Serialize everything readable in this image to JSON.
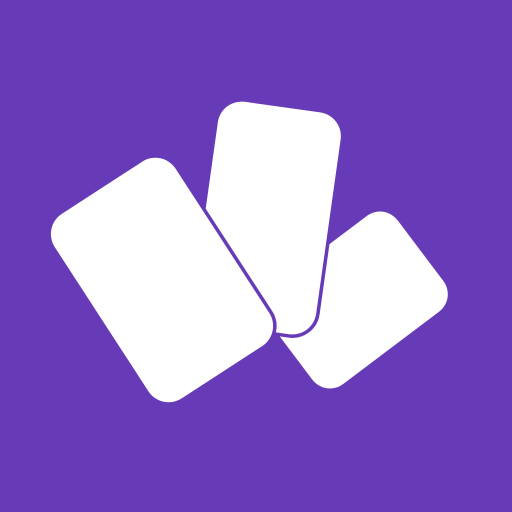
{
  "icon": {
    "name": "cards-icon",
    "background_color": "#673AB7",
    "card_color": "#FFFFFF",
    "outline_color": "#673AB7"
  }
}
